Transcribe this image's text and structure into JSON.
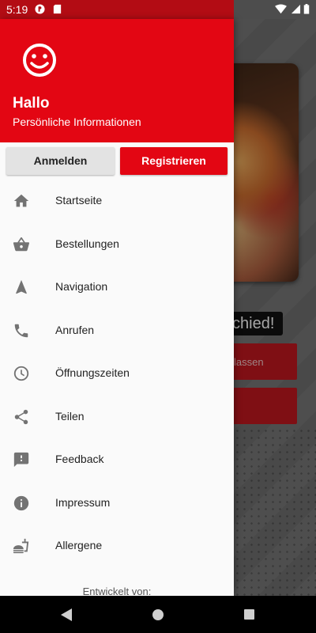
{
  "status_bar": {
    "time": "5:19",
    "icons": [
      "notification-icon",
      "sd-card-icon",
      "wifi-icon",
      "signal-icon",
      "battery-icon"
    ]
  },
  "background": {
    "pill_text": "chied!",
    "button_text": "lassen"
  },
  "drawer": {
    "header": {
      "avatar_icon": "smiley-face-icon",
      "title": "Hallo",
      "subtitle": "Persönliche Informationen"
    },
    "login_label": "Anmelden",
    "register_label": "Registrieren",
    "items": [
      {
        "label": "Startseite",
        "icon": "home-icon"
      },
      {
        "label": "Bestellungen",
        "icon": "basket-icon"
      },
      {
        "label": "Navigation",
        "icon": "navigation-icon"
      },
      {
        "label": "Anrufen",
        "icon": "phone-icon"
      },
      {
        "label": "Öffnungszeiten",
        "icon": "clock-icon"
      },
      {
        "label": "Teilen",
        "icon": "share-icon"
      },
      {
        "label": "Feedback",
        "icon": "feedback-icon"
      },
      {
        "label": "Impressum",
        "icon": "info-icon"
      },
      {
        "label": "Allergene",
        "icon": "allergens-icon"
      }
    ],
    "developed_by": "Entwickelt von:"
  },
  "nav_bar": {
    "buttons": [
      "back-icon",
      "home-circle-icon",
      "recent-apps-icon"
    ]
  },
  "colors": {
    "brand_red": "#e30613",
    "status_red": "#b30c14",
    "icon_gray": "#737373"
  }
}
